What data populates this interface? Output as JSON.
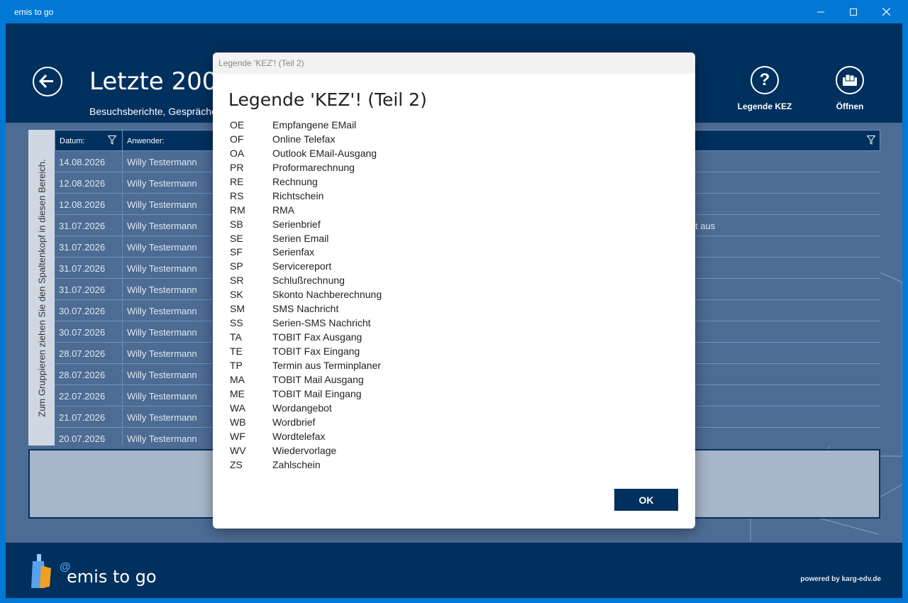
{
  "window": {
    "title": "emis to go",
    "controls": {
      "minimize": "—",
      "maximize": "☐",
      "close": "✕"
    }
  },
  "header": {
    "title": "Letzte 200 Aktivitäten",
    "subtitle": "Besuchsberichte, Gespräche",
    "buttons": [
      {
        "label": "Legende KEZ",
        "icon": "help-icon"
      },
      {
        "label": "Öffnen",
        "icon": "open-icon"
      }
    ]
  },
  "grid": {
    "group_hint": "Zum Gruppieren ziehen Sie den Spaltenkopf in diesen Bereich.",
    "columns": [
      "Datum:",
      "Anwender:"
    ],
    "rows": [
      {
        "date": "14.08.2026",
        "user": "Willy Testermann",
        "tail": ""
      },
      {
        "date": "12.08.2026",
        "user": "Willy Testermann",
        "tail": ""
      },
      {
        "date": "12.08.2026",
        "user": "Willy Testermann",
        "tail": ""
      },
      {
        "date": "31.07.2026",
        "user": "Willy Testermann",
        "tail": "t aus"
      },
      {
        "date": "31.07.2026",
        "user": "Willy Testermann",
        "tail": ""
      },
      {
        "date": "31.07.2026",
        "user": "Willy Testermann",
        "tail": ""
      },
      {
        "date": "31.07.2026",
        "user": "Willy Testermann",
        "tail": ""
      },
      {
        "date": "30.07.2026",
        "user": "Willy Testermann",
        "tail": ""
      },
      {
        "date": "30.07.2026",
        "user": "Willy Testermann",
        "tail": ""
      },
      {
        "date": "28.07.2026",
        "user": "Willy Testermann",
        "tail": ""
      },
      {
        "date": "28.07.2026",
        "user": "Willy Testermann",
        "tail": ""
      },
      {
        "date": "22.07.2026",
        "user": "Willy Testermann",
        "tail": ""
      },
      {
        "date": "21.07.2026",
        "user": "Willy Testermann",
        "tail": ""
      },
      {
        "date": "20.07.2026",
        "user": "Willy Testermann",
        "tail": ""
      }
    ]
  },
  "footer": {
    "brand": "emis to go",
    "brand_at": "@",
    "powered": "powered by karg-edv.de"
  },
  "dialog": {
    "window_title": "Legende 'KEZ'! (Teil 2)",
    "heading": "Legende 'KEZ'! (Teil 2)",
    "ok_label": "OK",
    "entries": [
      {
        "code": "OE",
        "desc": "Empfangene EMail"
      },
      {
        "code": "OF",
        "desc": "Online Telefax"
      },
      {
        "code": "OA",
        "desc": "Outlook EMail-Ausgang"
      },
      {
        "code": "PR",
        "desc": "Proformarechnung"
      },
      {
        "code": "RE",
        "desc": "Rechnung"
      },
      {
        "code": "RS",
        "desc": "Richtschein"
      },
      {
        "code": "RM",
        "desc": "RMA"
      },
      {
        "code": "SB",
        "desc": "Serienbrief"
      },
      {
        "code": "SE",
        "desc": "Serien Email"
      },
      {
        "code": "SF",
        "desc": "Serienfax"
      },
      {
        "code": "SP",
        "desc": "Servicereport"
      },
      {
        "code": "SR",
        "desc": "Schlußrechnung"
      },
      {
        "code": "SK",
        "desc": "Skonto Nachberechnung"
      },
      {
        "code": "SM",
        "desc": "SMS Nachricht"
      },
      {
        "code": "SS",
        "desc": "Serien-SMS Nachricht"
      },
      {
        "code": "TA",
        "desc": "TOBIT Fax Ausgang"
      },
      {
        "code": "TE",
        "desc": "TOBIT Fax Eingang"
      },
      {
        "code": "TP",
        "desc": "Termin aus Terminplaner"
      },
      {
        "code": "MA",
        "desc": "TOBIT Mail Ausgang"
      },
      {
        "code": "ME",
        "desc": "TOBIT Mail Eingang"
      },
      {
        "code": "WA",
        "desc": "Wordangebot"
      },
      {
        "code": "WB",
        "desc": "Wordbrief"
      },
      {
        "code": "WF",
        "desc": "Wordtelefax"
      },
      {
        "code": "WV",
        "desc": "Wiedervorlage"
      },
      {
        "code": "ZS",
        "desc": "Zahlschein"
      }
    ]
  }
}
